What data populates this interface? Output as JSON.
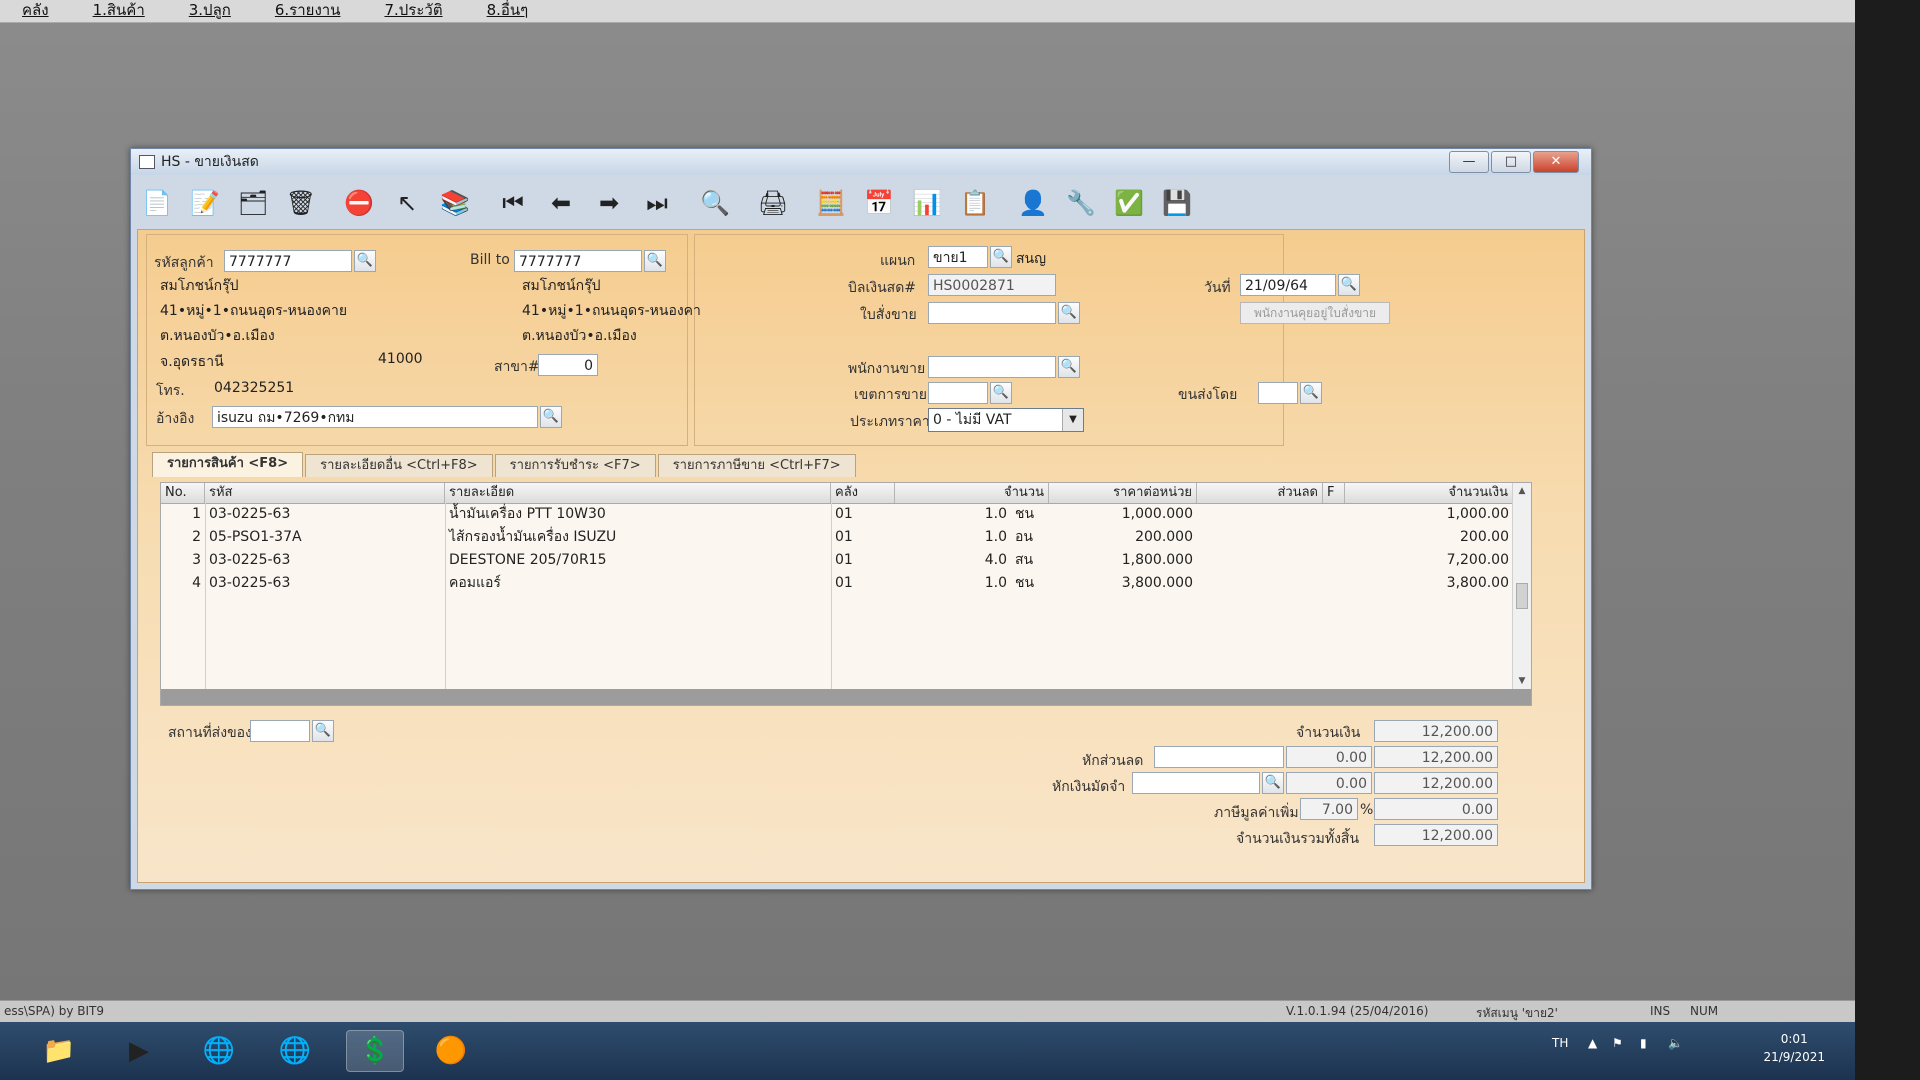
{
  "menubar": {
    "items": [
      "คลัง",
      "1.สินค้า",
      "3.ปลูก",
      "6.รายงาน",
      "7.ประวัติ",
      "8.อื่นๆ"
    ]
  },
  "window": {
    "title": "HS - ขายเงินสด",
    "min": "—",
    "max": "□",
    "close": "✕"
  },
  "toolbar": {
    "items": [
      {
        "name": "new-doc-icon",
        "glyph": "📄"
      },
      {
        "name": "edit-doc-icon",
        "glyph": "📝"
      },
      {
        "name": "void-doc-icon",
        "glyph": "🗂"
      },
      {
        "name": "trash-icon",
        "glyph": "🗑"
      },
      {
        "name": "cancel-icon",
        "glyph": "⛔"
      },
      {
        "name": "select-icon",
        "glyph": "↖"
      },
      {
        "name": "books-icon",
        "glyph": "📚"
      },
      {
        "name": "first-record-icon",
        "glyph": "⏮"
      },
      {
        "name": "prev-record-icon",
        "glyph": "⬅"
      },
      {
        "name": "next-record-icon",
        "glyph": "➡"
      },
      {
        "name": "last-record-icon",
        "glyph": "⏭"
      },
      {
        "name": "search-icon",
        "glyph": "🔍"
      },
      {
        "name": "print-icon",
        "glyph": "🖨"
      },
      {
        "name": "calc-icon",
        "glyph": "🧮"
      },
      {
        "name": "calendar-icon",
        "glyph": "📅"
      },
      {
        "name": "sheet-icon",
        "glyph": "📊"
      },
      {
        "name": "report-icon",
        "glyph": "📋"
      },
      {
        "name": "user-ok-icon",
        "glyph": "👤"
      },
      {
        "name": "tools-icon",
        "glyph": "🔧"
      },
      {
        "name": "ok-doc-icon",
        "glyph": "✅"
      },
      {
        "name": "export-icon",
        "glyph": "💾"
      }
    ]
  },
  "customer": {
    "code_label": "รหัสลูกค้า",
    "code": "7777777",
    "billto_label": "Bill to",
    "billto": "7777777",
    "name": "สมโภชน์กรุ๊ป",
    "addr1": "41•หมู่•1•ถนนอุดร-หนองคาย",
    "addr2": "ต.หนองบัว•อ.เมือง",
    "province": "จ.อุดรธานี",
    "zip": "41000",
    "bill_name": "สมโภชน์กรุ๊ป",
    "bill_addr1": "41•หมู่•1•ถนนอุดร-หนองคา",
    "bill_addr2": "ต.หนองบัว•อ.เมือง",
    "branch_label": "สาขา#",
    "branch": "0",
    "phone_label": "โทร.",
    "phone": "042325251",
    "ref_label": "อ้างอิง",
    "ref": "isuzu ถม•7269•กทม"
  },
  "doc": {
    "dept_label": "แผนก",
    "dept": "ขาย1",
    "dept_name": "สนญ",
    "bill_label": "บิลเงินสด#",
    "bill_no": "HS0002871",
    "date_label": "วันที่",
    "date": "21/09/64",
    "order_label": "ใบสั่งขาย",
    "order": "",
    "disabled_btn": "พนักงานคุยอยู่ใบสั่งขาย",
    "sales_label": "พนักงานขาย",
    "sales": "",
    "area_label": "เขตการขาย",
    "area": "",
    "ship_label": "ขนส่งโดย",
    "ship": "",
    "price_label": "ประเภทราคา",
    "price_type": "0 - ไม่มี VAT"
  },
  "tabs": [
    "รายการสินค้า <F8>",
    "รายละเอียดอื่น <Ctrl+F8>",
    "รายการรับชำระ <F7>",
    "รายการภาษีขาย <Ctrl+F7>"
  ],
  "grid": {
    "headers": {
      "no": "No.",
      "code": "รหัส",
      "desc": "รายละเอียด",
      "wh": "คลัง",
      "qty": "จำนวน",
      "price": "ราคาต่อหน่วย",
      "disc": "ส่วนลด",
      "f": "F",
      "amount": "จำนวนเงิน"
    },
    "rows": [
      {
        "no": "1",
        "code": "03-0225-63",
        "desc": "น้ำมันเครื่อง PTT 10W30",
        "wh": "01",
        "qty": "1.0",
        "unit": "ชน",
        "price": "1,000.000",
        "disc": "",
        "amount": "1,000.00"
      },
      {
        "no": "2",
        "code": "05-PSO1-37A",
        "desc": "ไส้กรองน้ำมันเครื่อง ISUZU",
        "wh": "01",
        "qty": "1.0",
        "unit": "อน",
        "price": "200.000",
        "disc": "",
        "amount": "200.00"
      },
      {
        "no": "3",
        "code": "03-0225-63",
        "desc": "DEESTONE 205/70R15",
        "wh": "01",
        "qty": "4.0",
        "unit": "สน",
        "price": "1,800.000",
        "disc": "",
        "amount": "7,200.00"
      },
      {
        "no": "4",
        "code": "03-0225-63",
        "desc": "คอมแอร์",
        "wh": "01",
        "qty": "1.0",
        "unit": "ชน",
        "price": "3,800.000",
        "disc": "",
        "amount": "3,800.00"
      }
    ]
  },
  "footer": {
    "ship_place_label": "สถานที่ส่งของ",
    "ship_place": "",
    "amount_label": "จำนวนเงิน",
    "amount": "12,200.00",
    "discount_label": "หักส่วนลด",
    "discount_input": "",
    "discount": "0.00",
    "after_discount": "12,200.00",
    "deposit_label": "หักเงินมัดจำ",
    "deposit_input": "",
    "deposit": "0.00",
    "after_deposit": "12,200.00",
    "vat_label": "ภาษีมูลค่าเพิ่ม",
    "vat_rate": "7.00",
    "pct": "%",
    "vat": "0.00",
    "total_label": "จำนวนเงินรวมทั้งสิ้น",
    "total": "12,200.00"
  },
  "status": {
    "left": "ess\\SPA) by BIT9",
    "version": "V.1.0.1.94 (25/04/2016)",
    "user": "รหัสเมนู 'ขาย2'",
    "ins": "INS",
    "num": "NUM"
  },
  "taskbar": {
    "lang": "TH",
    "time": "0:01",
    "date": "21/9/2021"
  }
}
